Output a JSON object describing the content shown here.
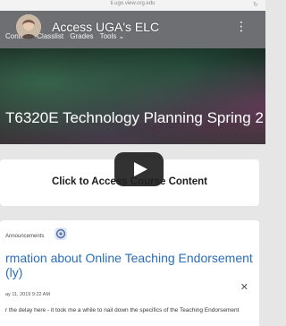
{
  "browser": {
    "url": "ti.ugo.view.org.edu"
  },
  "course_nav": {
    "items": [
      "Content",
      "Classlist",
      "Grades",
      "Tools ⌄"
    ]
  },
  "course": {
    "title": "T6320E Technology Planning Spring 2"
  },
  "access_card": {
    "label": "Click to Access Course Content"
  },
  "announcements": {
    "section_label": "Announcements",
    "title": "rmation about Online Teaching Endorsement (ly)",
    "date": "ay 11, 2019 9:22 AM",
    "body_preview": "r the delay here - it took me a while to nail down the specifics of the Teaching Endorsement"
  },
  "video": {
    "title": "Access UGA's ELC"
  }
}
